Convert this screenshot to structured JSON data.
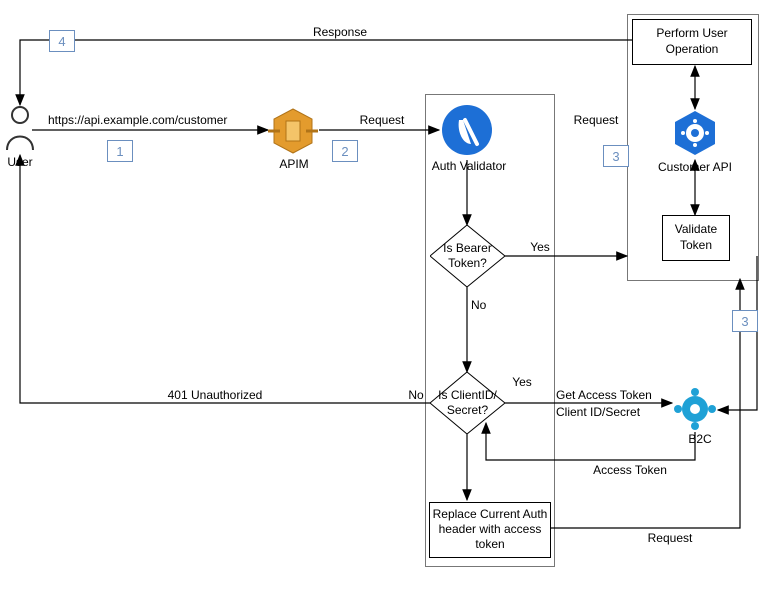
{
  "nodes": {
    "user": {
      "label": "User"
    },
    "apim": {
      "label": "APIM"
    },
    "auth_validator": {
      "label": "Auth Validator"
    },
    "customer_api": {
      "label": "Customer API"
    },
    "b2c": {
      "label": "B2C"
    }
  },
  "boxes": {
    "perform_user_operation": {
      "line1": "Perform User",
      "line2": "Operation"
    },
    "validate_token": {
      "line1": "Validate",
      "line2": "Token"
    },
    "replace_auth": {
      "line1": "Replace Current Auth",
      "line2": "header with access",
      "line3": "token"
    }
  },
  "decisions": {
    "is_bearer": {
      "line1": "Is Bearer",
      "line2": "Token?"
    },
    "is_clientid": {
      "line1": "Is ClientID/",
      "line2": "Secret?"
    }
  },
  "edges": {
    "url": "https://api.example.com/customer",
    "request1": "Request",
    "request2": "Request",
    "request3": "Request",
    "yes1": "Yes",
    "no1": "No",
    "yes2": "Yes",
    "no2": "No",
    "unauthorized": "401 Unauthorized",
    "get_access_token": "Get Access Token",
    "client_id_secret": "Client ID/Secret",
    "access_token": "Access Token",
    "response": "Response"
  },
  "steps": {
    "s1": "1",
    "s2": "2",
    "s3a": "3",
    "s3b": "3",
    "s4": "4"
  }
}
